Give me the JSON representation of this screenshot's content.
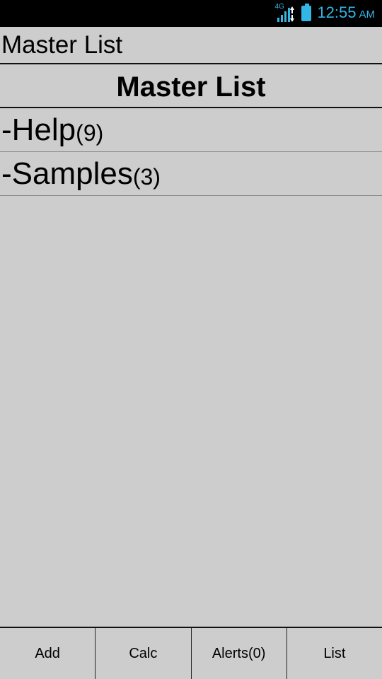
{
  "status_bar": {
    "network_type": "4G",
    "icons": [
      "signal-icon",
      "battery-icon"
    ],
    "time": "12:55",
    "ampm": "AM",
    "accent_color": "#33b5e5"
  },
  "app": {
    "title": "Master List"
  },
  "list": {
    "header": "Master List",
    "items": [
      {
        "label": "-Help",
        "count": "(9)"
      },
      {
        "label": "-Samples",
        "count": "(3)"
      }
    ]
  },
  "bottom_bar": {
    "buttons": [
      {
        "label": "Add"
      },
      {
        "label": "Calc"
      },
      {
        "label": "Alerts(0)"
      },
      {
        "label": "List"
      }
    ]
  }
}
